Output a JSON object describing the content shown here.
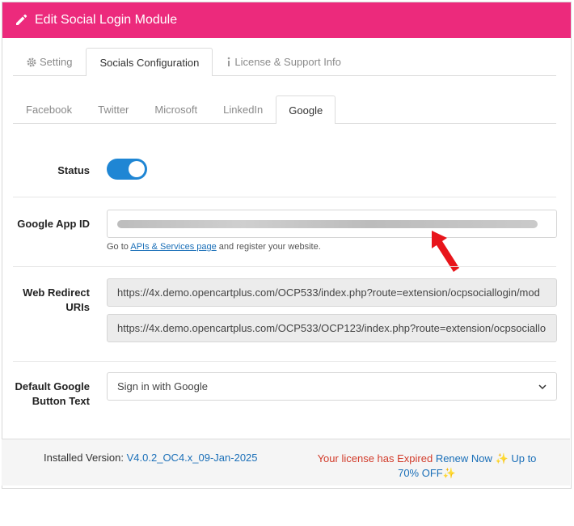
{
  "header": {
    "title": "Edit Social Login Module"
  },
  "main_tabs": [
    {
      "label": "Setting",
      "icon": "gear-icon"
    },
    {
      "label": "Socials Configuration"
    },
    {
      "label": "License & Support Info",
      "icon": "info-icon"
    }
  ],
  "social_tabs": [
    "Facebook",
    "Twitter",
    "Microsoft",
    "LinkedIn",
    "Google"
  ],
  "form": {
    "status_label": "Status",
    "status_on": true,
    "app_id_label": "Google App ID",
    "help_prefix": "Go to ",
    "help_link": "APIs & Services page",
    "help_suffix": " and register your website.",
    "redirect_label": "Web Redirect URIs",
    "redirect_uri_1": "https://4x.demo.opencartplus.com/OCP533/index.php?route=extension/ocpsociallogin/mod",
    "redirect_uri_2": "https://4x.demo.opencartplus.com/OCP533/OCP123/index.php?route=extension/ocpsociallo",
    "button_text_label": "Default Google Button Text",
    "button_text_value": "Sign in with Google"
  },
  "footer": {
    "installed_label": "Installed Version: ",
    "version": "V4.0.2_OC4.x_09-Jan-2025",
    "expired": "Your license has Expired",
    "renew": "Renew Now",
    "offer": "Up to 70% OFF",
    "spark": "✨"
  },
  "colors": {
    "header": "#ec2a7c",
    "toggle": "#1f86d4",
    "link": "#1a6fb8",
    "expired": "#d23b2a",
    "arrow": "#e8151b"
  }
}
